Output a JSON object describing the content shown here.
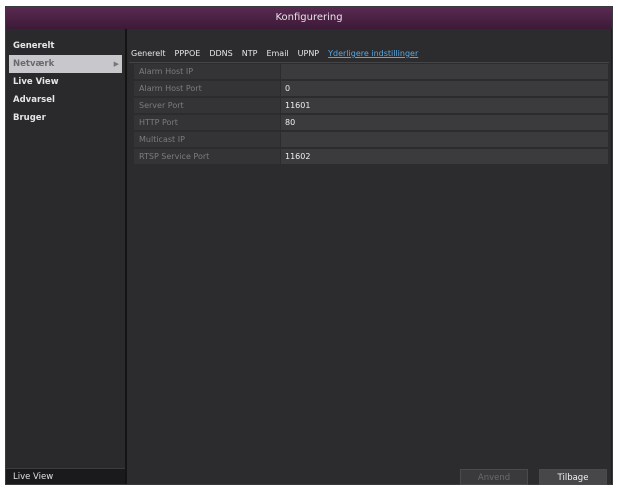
{
  "window": {
    "title": "Konfigurering"
  },
  "sidebar": {
    "items": [
      {
        "label": "Generelt",
        "name": "sidebar-item-generelt"
      },
      {
        "label": "Netværk",
        "name": "sidebar-item-netvaerk",
        "active": true
      },
      {
        "label": "Live View",
        "name": "sidebar-item-live-view"
      },
      {
        "label": "Advarsel",
        "name": "sidebar-item-advarsel"
      },
      {
        "label": "Bruger",
        "name": "sidebar-item-bruger"
      }
    ],
    "bottom_label": "Live View"
  },
  "tabs": [
    {
      "label": "Generelt"
    },
    {
      "label": "PPPOE"
    },
    {
      "label": "DDNS"
    },
    {
      "label": "NTP"
    },
    {
      "label": "Email"
    },
    {
      "label": "UPNP"
    },
    {
      "label": "Yderligere indstillinger",
      "active": true
    }
  ],
  "form": {
    "rows": [
      {
        "label": "Alarm Host IP",
        "value": ""
      },
      {
        "label": "Alarm Host Port",
        "value": "0"
      },
      {
        "label": "Server Port",
        "value": "11601"
      },
      {
        "label": "HTTP Port",
        "value": "80"
      },
      {
        "label": "Multicast IP",
        "value": ""
      },
      {
        "label": "RTSP Service Port",
        "value": "11602"
      }
    ]
  },
  "buttons": {
    "apply_label": "Anvend",
    "back_label": "Tilbage"
  },
  "colors": {
    "titlebar": "#4a2245",
    "active_tab": "#5aa7e0",
    "background": "#2c2c2e"
  }
}
